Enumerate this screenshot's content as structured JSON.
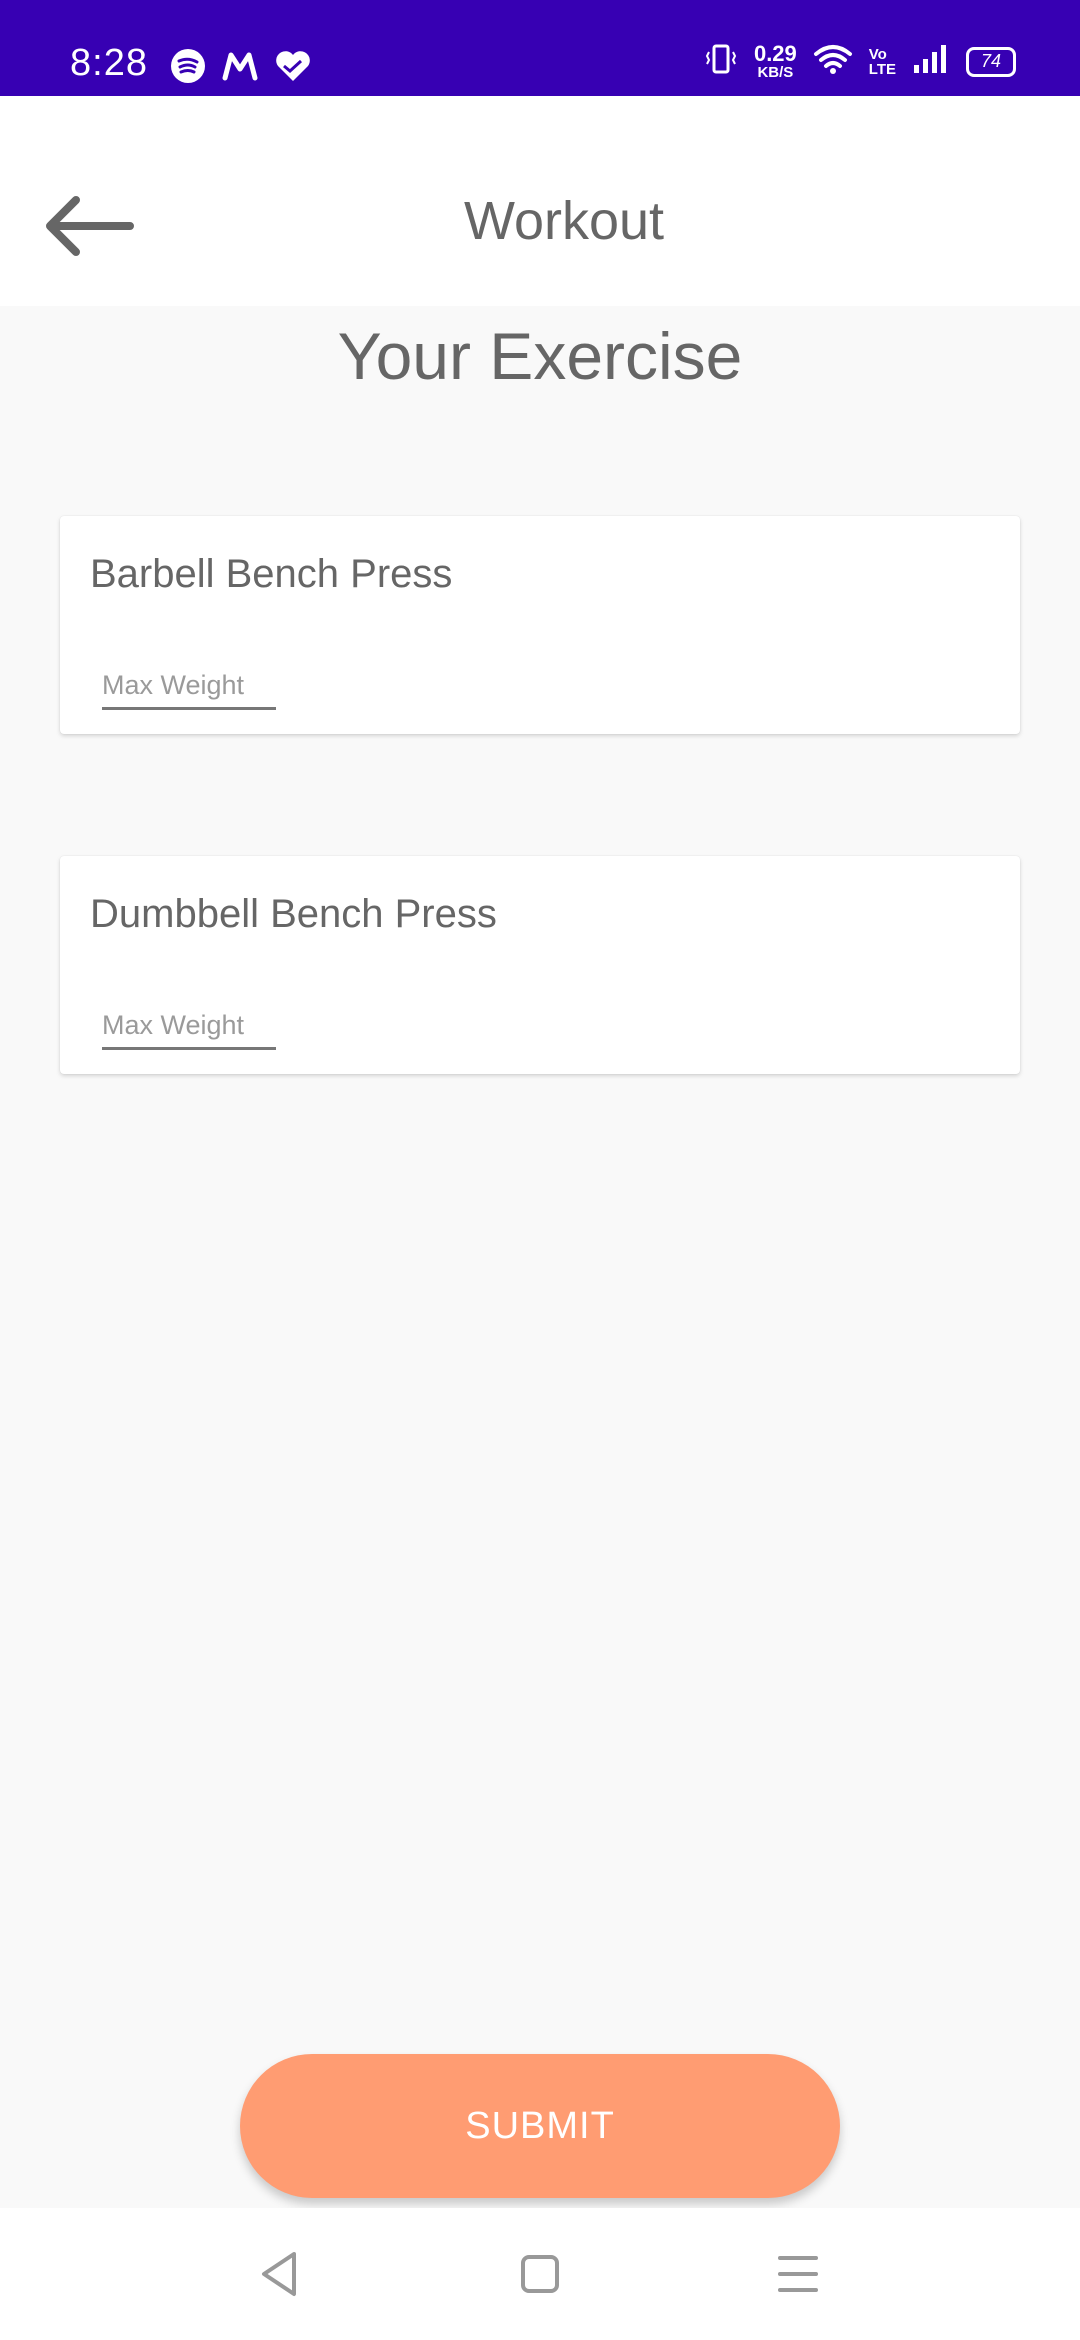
{
  "status_bar": {
    "time": "8:28",
    "net_speed_value": "0.29",
    "net_speed_unit": "KB/S",
    "volte_top": "Vo",
    "volte_bottom": "LTE",
    "battery": "74",
    "bg_color": "#3700b3"
  },
  "app_bar": {
    "title": "Workout",
    "back_icon": "arrow-left-icon"
  },
  "main": {
    "section_title": "Your Exercise",
    "exercises": [
      {
        "name": "Barbell Bench Press",
        "input_placeholder": "Max Weight",
        "input_value": ""
      },
      {
        "name": "Dumbbell Bench Press",
        "input_placeholder": "Max Weight",
        "input_value": ""
      }
    ]
  },
  "submit": {
    "label": "SUBMIT",
    "color": "#ff9c72"
  },
  "nav_bar": {
    "icons": [
      "back-triangle-icon",
      "home-square-icon",
      "menu-lines-icon"
    ]
  }
}
